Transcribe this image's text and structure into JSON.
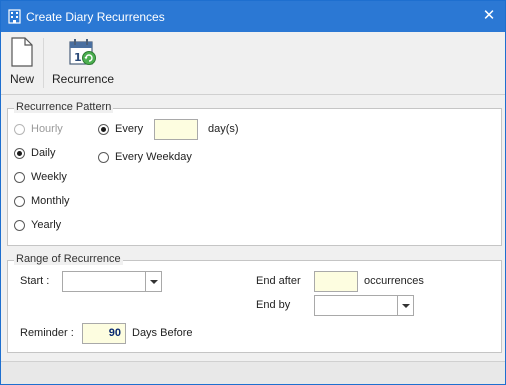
{
  "window": {
    "title": "Create Diary Recurrences",
    "title_icon": "building-icon",
    "close_icon": "close-icon",
    "titlebar_color": "#2b78d4"
  },
  "toolbar": {
    "new_label": "New",
    "new_icon": "document-icon",
    "recurrence_label": "Recurrence",
    "recurrence_icon": "calendar-recurrence-icon"
  },
  "pattern": {
    "legend": "Recurrence Pattern",
    "options": [
      {
        "label": "Hourly",
        "checked": false,
        "enabled": false
      },
      {
        "label": "Daily",
        "checked": true,
        "enabled": true
      },
      {
        "label": "Weekly",
        "checked": false,
        "enabled": true
      },
      {
        "label": "Monthly",
        "checked": false,
        "enabled": true
      },
      {
        "label": "Yearly",
        "checked": false,
        "enabled": true
      }
    ],
    "every_label": "Every",
    "every_value": "",
    "every_unit": "day(s)",
    "every_weekday_label": "Every Weekday"
  },
  "range": {
    "legend": "Range of Recurrence",
    "start_label": "Start :",
    "start_value": "",
    "end_after_label": "End after",
    "end_after_value": "",
    "occurrences_label": "occurrences",
    "end_by_label": "End by",
    "end_by_value": "",
    "reminder_label": "Reminder :",
    "reminder_value": "90",
    "reminder_unit": "Days Before"
  }
}
